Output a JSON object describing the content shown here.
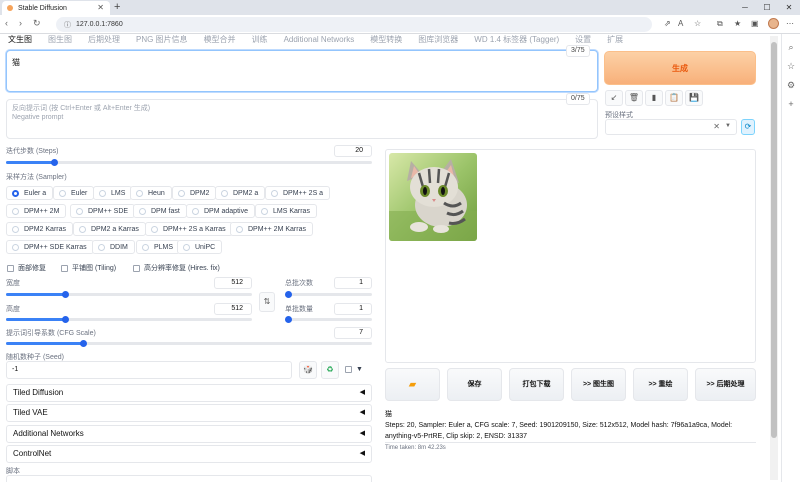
{
  "browser": {
    "tab_title": "Stable Diffusion",
    "url": "127.0.0.1:7860"
  },
  "tabs": [
    "文生图",
    "图生图",
    "后期处理",
    "PNG 图片信息",
    "模型合并",
    "训练",
    "Additional Networks",
    "模型转换",
    "图库浏览器",
    "WD 1.4 标签器 (Tagger)",
    "设置",
    "扩展"
  ],
  "prompt": {
    "value": "猫",
    "counter": "3/75",
    "negative_counter": "0/75",
    "negative_placeholder_line1": "反向提示词 (按 Ctrl+Enter 或 Alt+Enter 生成)",
    "negative_placeholder_line2": "Negative prompt"
  },
  "generate_label": "生成",
  "style": {
    "label": "预设样式"
  },
  "steps": {
    "label": "迭代步数 (Steps)",
    "value": "20",
    "fraction": 0.13
  },
  "sampler": {
    "label": "采样方法 (Sampler)",
    "selected": "Euler a",
    "options": [
      "Euler a",
      "Euler",
      "LMS",
      "Heun",
      "DPM2",
      "DPM2 a",
      "DPM++ 2S a",
      "DPM++ 2M",
      "DPM++ SDE",
      "DPM fast",
      "DPM adaptive",
      "LMS Karras",
      "DPM2 Karras",
      "DPM2 a Karras",
      "DPM++ 2S a Karras",
      "DPM++ 2M Karras",
      "DPM++ SDE Karras",
      "DDIM",
      "PLMS",
      "UniPC"
    ]
  },
  "checks": [
    "面部修复",
    "平铺图 (Tiling)",
    "高分辨率修复 (Hires. fix)"
  ],
  "width": {
    "label": "宽度",
    "value": "512",
    "fraction": 0.24
  },
  "height": {
    "label": "高度",
    "value": "512",
    "fraction": 0.24
  },
  "batch_count": {
    "label": "总批次数",
    "value": "1",
    "fraction": 0.0
  },
  "batch_size": {
    "label": "单批数量",
    "value": "1",
    "fraction": 0.0
  },
  "cfg": {
    "label": "提示词引导系数 (CFG Scale)",
    "value": "7",
    "fraction": 0.21
  },
  "seed": {
    "label": "随机数种子 (Seed)",
    "value": "-1"
  },
  "accordions": [
    "Tiled Diffusion",
    "Tiled VAE",
    "Additional Networks",
    "ControlNet"
  ],
  "script_label": "脚本",
  "output_buttons": [
    "保存",
    "打包下载",
    ">> 图生图",
    ">> 重绘",
    ">> 后期处理"
  ],
  "info": {
    "prompt": "猫",
    "params": "Steps: 20, Sampler: Euler a, CFG scale: 7, Seed: 1901209150, Size: 512x512, Model hash: 7f96a1a9ca, Model: anything-v5-PrtRE, Clip skip: 2, ENSD: 31337",
    "time": "Time taken: 8m 42.23s"
  },
  "colors": {
    "accent": "#2563eb",
    "generate_bg": "#f8b07a",
    "generate_text": "#ea580c"
  }
}
